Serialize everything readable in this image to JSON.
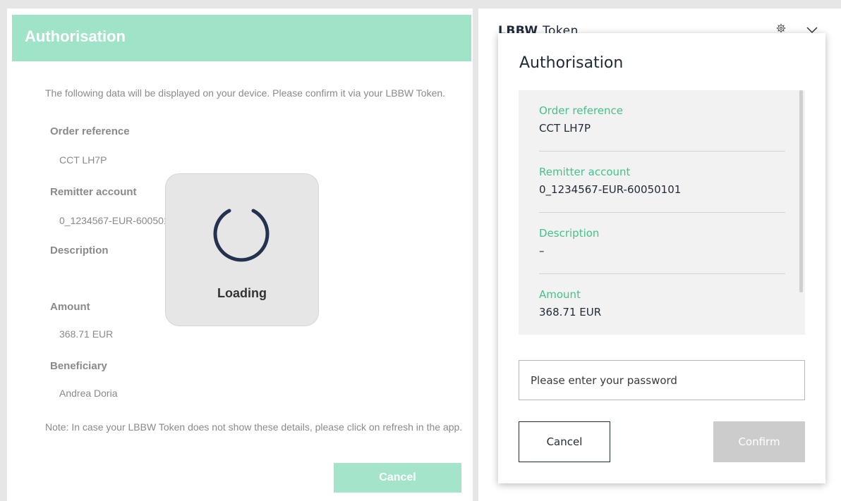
{
  "left_dialog": {
    "title": "Authorisation",
    "intro": "The following data will be displayed on your device. Please confirm it via your LBBW Token.",
    "fields": [
      {
        "label": "Order reference",
        "value": "CCT LH7P"
      },
      {
        "label": "Remitter account",
        "value": "0_1234567-EUR-60050101"
      },
      {
        "label": "Description",
        "value": ""
      },
      {
        "label": "Amount",
        "value": "368.71 EUR"
      },
      {
        "label": "Beneficiary",
        "value": "Andrea Doria"
      }
    ],
    "note": "Note: In case your LBBW Token does not show these details, please click on refresh in the app.",
    "cancel_label": "Cancel"
  },
  "loading": {
    "text": "Loading"
  },
  "token_app": {
    "brand": "LBBW",
    "brand_suffix": "Token",
    "title": "Authorisation",
    "fields": [
      {
        "label": "Order reference",
        "value": "CCT LH7P"
      },
      {
        "label": "Remitter account",
        "value": "0_1234567-EUR-60050101"
      },
      {
        "label": "Description",
        "value": "–"
      },
      {
        "label": "Amount",
        "value": "368.71 EUR"
      }
    ],
    "password_placeholder": "Please enter your password",
    "cancel_label": "Cancel",
    "confirm_label": "Confirm"
  },
  "colors": {
    "header_green": "#9fe3c9",
    "label_green": "#45c28a",
    "navy": "#222b38",
    "disabled_gray": "#cccccc"
  }
}
